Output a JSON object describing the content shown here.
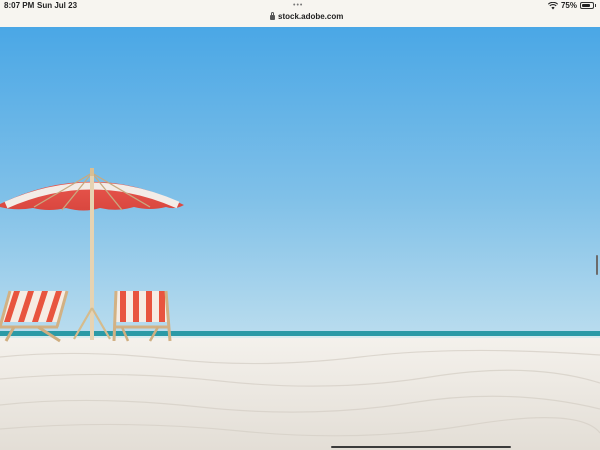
{
  "status_bar": {
    "time": "8:07 PM",
    "date": "Sun Jul 23",
    "url": "stock.adobe.com",
    "battery_percent": "75%",
    "battery_level": 0.75,
    "icons": [
      "lock-icon",
      "wifi-icon",
      "battery-icon",
      "more-dots-icon"
    ]
  },
  "scene": {
    "description_icon": "beach-photo",
    "colors": {
      "sky_top": "#4aa7e6",
      "sky_bottom": "#b9dcee",
      "sea": "#2b9aa6",
      "sand": "#ece8e2",
      "umbrella_red": "#e4584f",
      "chair_stripe": "#e8543f"
    }
  }
}
